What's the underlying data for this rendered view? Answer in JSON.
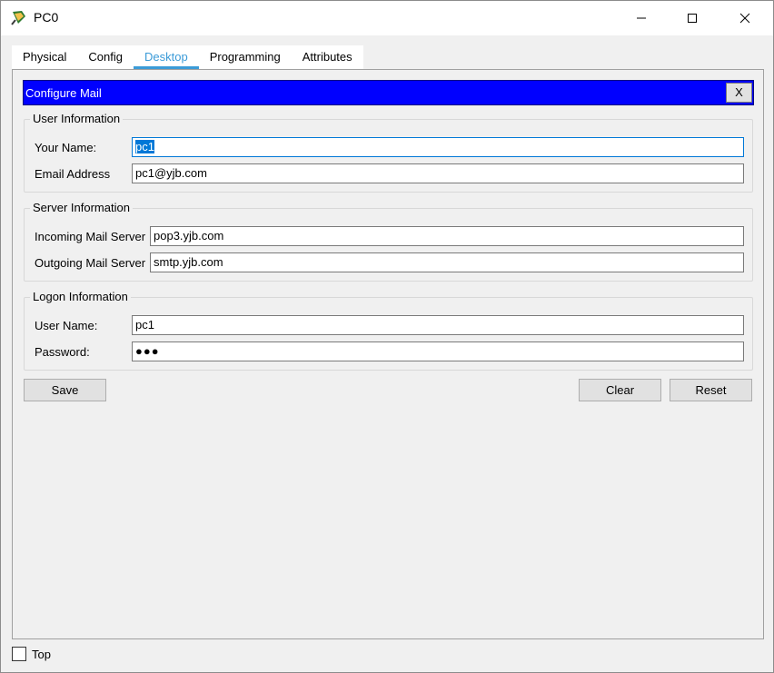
{
  "window": {
    "title": "PC0",
    "icon": "packet-tracer-pc-icon"
  },
  "tabs": [
    {
      "label": "Physical",
      "active": false
    },
    {
      "label": "Config",
      "active": false
    },
    {
      "label": "Desktop",
      "active": true
    },
    {
      "label": "Programming",
      "active": false
    },
    {
      "label": "Attributes",
      "active": false
    }
  ],
  "mail": {
    "header_title": "Configure Mail",
    "close_label": "X",
    "user_info": {
      "legend": "User Information",
      "your_name_label": "Your Name:",
      "your_name_value": "pc1",
      "email_label": "Email Address",
      "email_value": "pc1@yjb.com"
    },
    "server_info": {
      "legend": "Server Information",
      "incoming_label": "Incoming Mail Server",
      "incoming_value": "pop3.yjb.com",
      "outgoing_label": "Outgoing Mail Server",
      "outgoing_value": "smtp.yjb.com"
    },
    "logon_info": {
      "legend": "Logon Information",
      "username_label": "User Name:",
      "username_value": "pc1",
      "password_label": "Password:",
      "password_value": "●●●"
    },
    "buttons": {
      "save": "Save",
      "clear": "Clear",
      "reset": "Reset"
    }
  },
  "footer": {
    "top_label": "Top",
    "top_checked": false
  },
  "colors": {
    "header_blue": "#0000ff",
    "tab_active": "#3b9bd8",
    "selection": "#0078d7"
  }
}
